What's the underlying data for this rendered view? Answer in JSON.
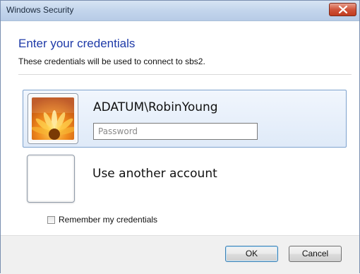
{
  "window": {
    "title": "Windows Security"
  },
  "dialog": {
    "heading": "Enter your credentials",
    "subheading": "These credentials will be used to connect to sbs2."
  },
  "account": {
    "name": "ADATUM\\RobinYoung",
    "password_placeholder": "Password",
    "password_value": ""
  },
  "other_account": {
    "label": "Use another account"
  },
  "remember": {
    "label": "Remember my credentials",
    "checked": false
  },
  "buttons": {
    "ok_label": "OK",
    "cancel_label": "Cancel"
  },
  "colors": {
    "heading": "#1e3aa8",
    "selected_tile_border": "#7da2ce",
    "close_button": "#c13b1f"
  }
}
